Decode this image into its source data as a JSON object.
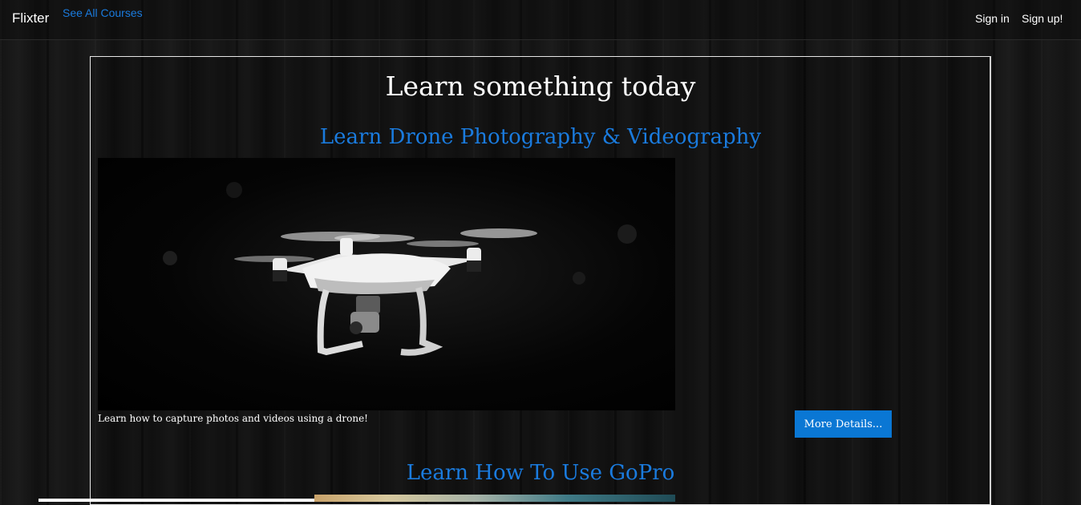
{
  "nav": {
    "brand": "Flixter",
    "see_all": "See All Courses",
    "signin": "Sign in",
    "signup": "Sign up!"
  },
  "main": {
    "title": "Learn something today",
    "courses": [
      {
        "title": "Learn Drone Photography & Videography",
        "description": "Learn how to capture photos and videos using a drone!",
        "button": "More Details...",
        "image_icon": "drone-image"
      },
      {
        "title": "Learn How To Use GoPro"
      }
    ]
  },
  "colors": {
    "accent": "#1a7bde",
    "button": "#0a77d4",
    "background": "#151515"
  }
}
